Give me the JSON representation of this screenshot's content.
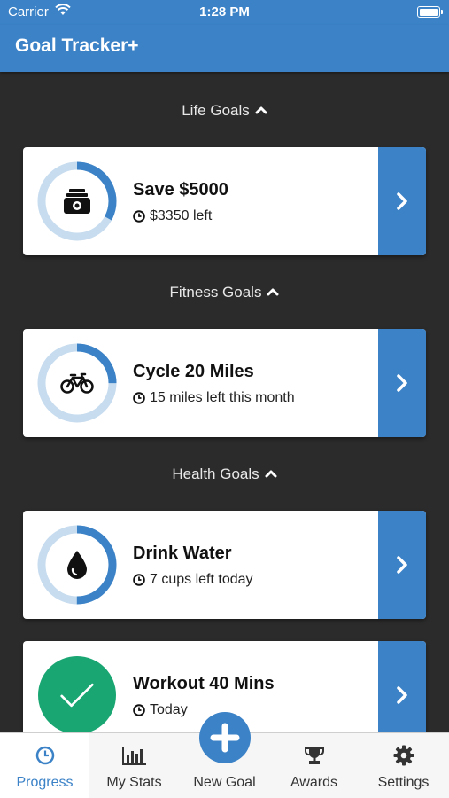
{
  "status_bar": {
    "carrier": "Carrier",
    "time": "1:28 PM"
  },
  "nav": {
    "title": "Goal Tracker+"
  },
  "colors": {
    "accent": "#3b82c7",
    "ring_track": "#c7dcef",
    "success": "#1aa673",
    "background": "#2b2b2b"
  },
  "sections": [
    {
      "label": "Life Goals"
    },
    {
      "label": "Fitness Goals"
    },
    {
      "label": "Health Goals"
    }
  ],
  "goals": [
    {
      "title": "Save $5000",
      "subtitle": "$3350 left",
      "progress": 0.33,
      "icon": "money-icon"
    },
    {
      "title": "Cycle 20 Miles",
      "subtitle": "15 miles left this month",
      "progress": 0.25,
      "icon": "bicycle-icon"
    },
    {
      "title": "Drink Water",
      "subtitle": "7 cups left today",
      "progress": 0.5,
      "icon": "water-drop-icon"
    },
    {
      "title": "Workout 40 Mins",
      "subtitle": "Today",
      "progress": 1.0,
      "icon": "checkmark-icon"
    }
  ],
  "tabs": [
    {
      "label": "Progress",
      "icon": "clock-icon",
      "active": true
    },
    {
      "label": "My Stats",
      "icon": "bar-chart-icon"
    },
    {
      "label": "New Goal",
      "icon": "plus-icon"
    },
    {
      "label": "Awards",
      "icon": "trophy-icon"
    },
    {
      "label": "Settings",
      "icon": "gear-icon"
    }
  ]
}
